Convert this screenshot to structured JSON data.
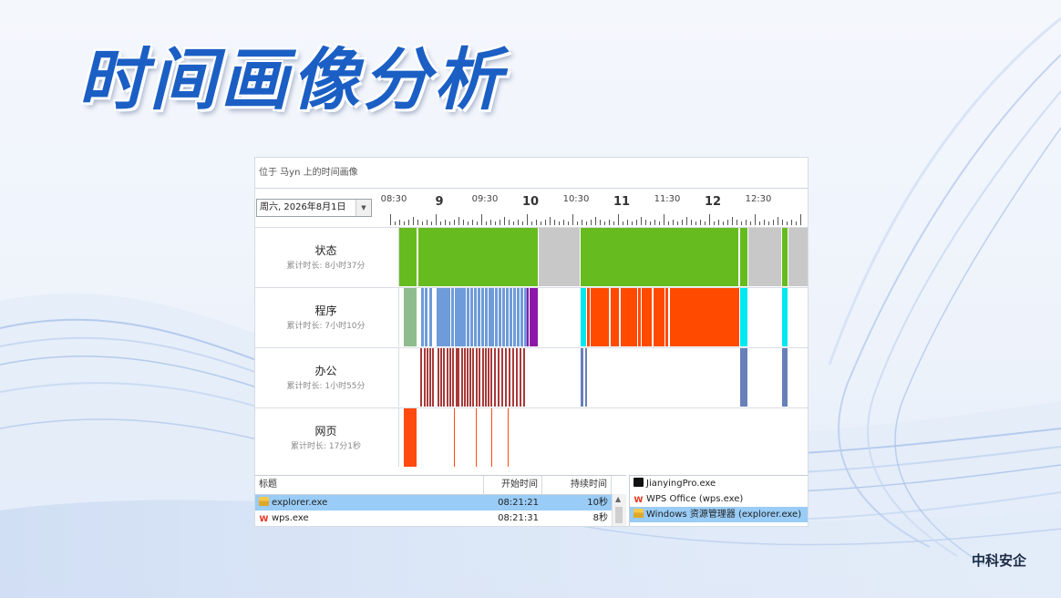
{
  "slide": {
    "title": "时间画像分析",
    "brand": "中科安企"
  },
  "window": {
    "header": "位于 马yn 上的时间画像",
    "date": "周六, 2026年8月1日"
  },
  "timeline": {
    "labels": [
      {
        "text": "08:30",
        "major": false
      },
      {
        "text": "9",
        "major": true
      },
      {
        "text": "09:30",
        "major": false
      },
      {
        "text": "10",
        "major": true
      },
      {
        "text": "10:30",
        "major": false
      },
      {
        "text": "11",
        "major": true
      },
      {
        "text": "11:30",
        "major": false
      },
      {
        "text": "12",
        "major": true
      },
      {
        "text": "12:30",
        "major": false
      }
    ]
  },
  "rows": [
    {
      "name": "状态",
      "sub": "累计时长: 8小时37分"
    },
    {
      "name": "程序",
      "sub": "累计时长: 7小时10分"
    },
    {
      "name": "办公",
      "sub": "累计时长: 1小时55分"
    },
    {
      "name": "网页",
      "sub": "累计时长: 17分1秒"
    }
  ],
  "colors": {
    "active": "#66bb1f",
    "idle": "#c8c8c8",
    "program_green": "#8fbc8f",
    "program_blue": "#6e9bd9",
    "program_purple": "#8b18a8",
    "program_orange": "#ff4a00",
    "program_cyan": "#00e8f0",
    "office_red": "#a83a3a",
    "office_blue": "#6880b8",
    "web_orange": "#ff4a10"
  },
  "table": {
    "headers": {
      "title": "标题",
      "start": "开始时间",
      "duration": "持续时间"
    },
    "rows": [
      {
        "icon": "explorer-folder-icon",
        "title": "explorer.exe",
        "start": "08:21:21",
        "duration": "10秒",
        "selected": true
      },
      {
        "icon": "wps-icon",
        "title": "wps.exe",
        "start": "08:21:31",
        "duration": "8秒",
        "selected": false
      }
    ]
  },
  "apps": [
    {
      "icon": "jianying-icon",
      "label": "JianyingPro.exe",
      "selected": false
    },
    {
      "icon": "wps-icon",
      "label": "WPS Office (wps.exe)",
      "selected": false
    },
    {
      "icon": "explorer-folder-icon",
      "label": "Windows 资源管理器 (explorer.exe)",
      "selected": true
    }
  ]
}
